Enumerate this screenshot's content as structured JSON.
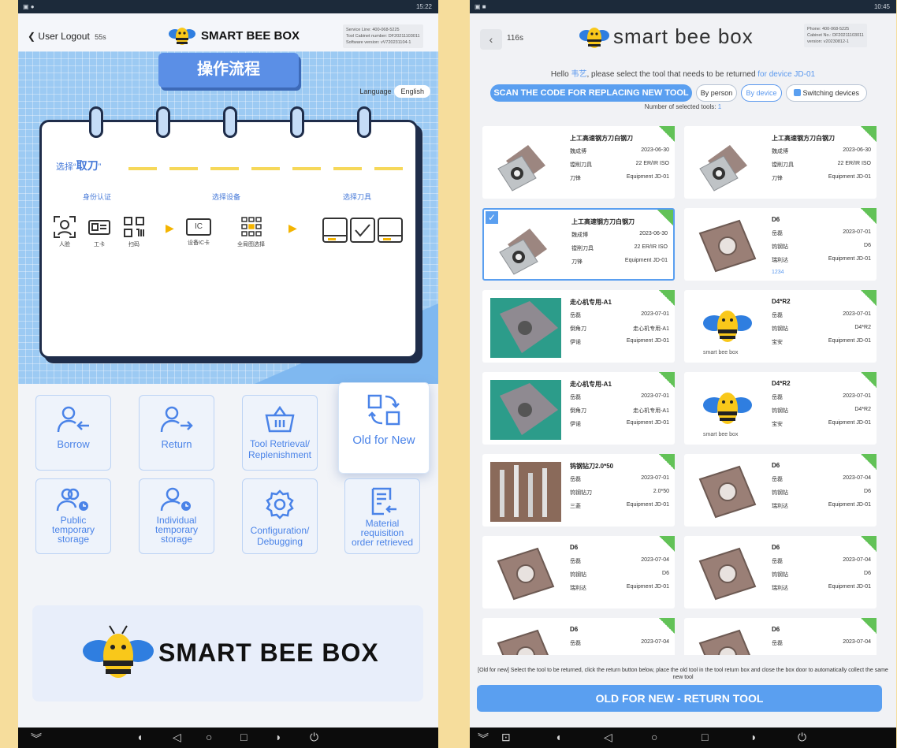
{
  "left": {
    "status_time": "15:22",
    "logout_label": "User Logout",
    "logout_timer": "55s",
    "brand": "SMART BEE BOX",
    "service_info": [
      "Service Line: 400-068-5225",
      "Tool Cabinet number: DF20211103011",
      "Software version: vV720231104-1"
    ],
    "process_title": "操作流程",
    "language_label": "Language",
    "language_value": "English",
    "step_title_prefix": "选择“",
    "step_title_bold": "取刀",
    "step_title_suffix": "”",
    "phase1": "身份认证",
    "phase2": "选择设备",
    "phase3": "选择刀具",
    "id_face": "人脸",
    "id_card": "工卡",
    "id_scan": "扫码",
    "dev_ic": "设备IC卡",
    "dev_all": "全局图选择",
    "ic_text": "IC",
    "tiles": {
      "borrow": "Borrow",
      "return": "Return",
      "retrieval_1": "Tool Retrieval/",
      "retrieval_2": "Replenishment",
      "old_new": "Old for New",
      "pub_1": "Public",
      "pub_2": "temporary",
      "pub_3": "storage",
      "ind_1": "Individual",
      "ind_2": "temporary",
      "ind_3": "storage",
      "cfg_1": "Configuration/",
      "cfg_2": "Debugging",
      "mat_1": "Material",
      "mat_2": "requisition",
      "mat_3": "order retrieved"
    },
    "big_brand": "SMART BEE BOX"
  },
  "right": {
    "status_time": "10:45",
    "back_timer": "116s",
    "brand": "smart bee box",
    "info": [
      "Phone: 400-068-5225",
      "Cabinet No.: DF20211103011",
      "version: v20230812-1"
    ],
    "hello_prefix": "Hello ",
    "user": "韦艺",
    "hello_mid": ", please select the tool that needs to be returned ",
    "device": "for device JD-01",
    "scan_btn": "SCAN THE CODE FOR REPLACING NEW TOOL",
    "by_person": "By person",
    "by_device": "By device",
    "switching": "Switching devices",
    "selected_label": "Number of selected tools: ",
    "selected_count": "1",
    "items": [
      {
        "name": "上工高速钢方刀白钢刀",
        "r1a": "魏成博",
        "r1b": "2023-06-30",
        "r2a": "镗削刀具",
        "r2b": "22 ER/IR ISO",
        "r3a": "刀锋",
        "r3b": "Equipment JD-01",
        "extra": ""
      },
      {
        "name": "上工高速钢方刀白钢刀",
        "r1a": "魏成博",
        "r1b": "2023-06-30",
        "r2a": "镗削刀具",
        "r2b": "22 ER/IR ISO",
        "r3a": "刀锋",
        "r3b": "Equipment JD-01",
        "extra": ""
      },
      {
        "name": "上工高速钢方刀白钢刀",
        "r1a": "魏成博",
        "r1b": "2023-06-30",
        "r2a": "镗削刀具",
        "r2b": "22 ER/IR ISO",
        "r3a": "刀锋",
        "r3b": "Equipment JD-01",
        "extra": ""
      },
      {
        "name": "D6",
        "r1a": "岳磊",
        "r1b": "2023-07-01",
        "r2a": "钨钢钻",
        "r2b": "D6",
        "r3a": "瑞利达",
        "r3b": "Equipment JD-01",
        "extra": "1234"
      },
      {
        "name": "走心机专用-A1",
        "r1a": "岳磊",
        "r1b": "2023-07-01",
        "r2a": "倒角刀",
        "r2b": "走心机专用-A1",
        "r3a": "伊诺",
        "r3b": "Equipment JD-01",
        "extra": ""
      },
      {
        "name": "D4*R2",
        "r1a": "岳磊",
        "r1b": "2023-07-01",
        "r2a": "钨钢钻",
        "r2b": "D4*R2",
        "r3a": "宝安",
        "r3b": "Equipment JD-01",
        "extra": ""
      },
      {
        "name": "走心机专用-A1",
        "r1a": "岳磊",
        "r1b": "2023-07-01",
        "r2a": "倒角刀",
        "r2b": "走心机专用-A1",
        "r3a": "伊诺",
        "r3b": "Equipment JD-01",
        "extra": ""
      },
      {
        "name": "D4*R2",
        "r1a": "岳磊",
        "r1b": "2023-07-01",
        "r2a": "钨钢钻",
        "r2b": "D4*R2",
        "r3a": "宝安",
        "r3b": "Equipment JD-01",
        "extra": ""
      },
      {
        "name": "钨钢钻刀2.0*50",
        "r1a": "岳磊",
        "r1b": "2023-07-01",
        "r2a": "钨钢钻刀",
        "r2b": "2.0*50",
        "r3a": "三菱",
        "r3b": "Equipment JD-01",
        "extra": ""
      },
      {
        "name": "D6",
        "r1a": "岳磊",
        "r1b": "2023-07-04",
        "r2a": "钨钢钻",
        "r2b": "D6",
        "r3a": "瑞利达",
        "r3b": "Equipment JD-01",
        "extra": ""
      },
      {
        "name": "D6",
        "r1a": "岳磊",
        "r1b": "2023-07-04",
        "r2a": "钨钢钻",
        "r2b": "D6",
        "r3a": "瑞利达",
        "r3b": "Equipment JD-01",
        "extra": ""
      },
      {
        "name": "D6",
        "r1a": "岳磊",
        "r1b": "2023-07-04",
        "r2a": "钨钢钻",
        "r2b": "D6",
        "r3a": "瑞利达",
        "r3b": "Equipment JD-01",
        "extra": ""
      },
      {
        "name": "D6",
        "r1a": "岳磊",
        "r1b": "2023-07-04",
        "r2a": "",
        "r2b": "",
        "r3a": "",
        "r3b": "",
        "extra": ""
      },
      {
        "name": "D6",
        "r1a": "岳磊",
        "r1b": "2023-07-04",
        "r2a": "",
        "r2b": "",
        "r3a": "",
        "r3b": "",
        "extra": ""
      }
    ],
    "bee_caption": "smart bee box",
    "hint": "[Old for new] Select the tool to be returned, click the return button below, place the old tool in the tool return box and close the box door to automatically collect the same new tool",
    "return_btn": "OLD FOR NEW - RETURN TOOL"
  },
  "colors": {
    "accent": "#5a9ff0",
    "background": "#f6dd9c",
    "hero": "#9ccaf3",
    "tile_text": "#4a83e8",
    "badge": "#62c257"
  }
}
